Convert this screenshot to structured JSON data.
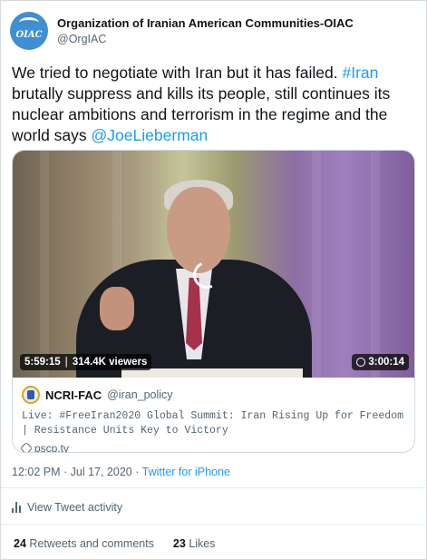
{
  "author": {
    "avatar_text": "OIAC",
    "display_name": "Organization of Iranian American Communities-OIAC",
    "handle": "@OrgIAC"
  },
  "tweet": {
    "text_1": "We tried to negotiate with Iran but it has failed. ",
    "hashtag": "#Iran",
    "text_2": " brutally suppress and kills its people, still continues its nuclear ambitions and terrorism in the regime and the world says ",
    "mention": "@JoeLieberman"
  },
  "card": {
    "elapsed": "5:59:15",
    "viewers": "314.4K viewers",
    "duration": "3:00:14",
    "account_name": "NCRI-FAC",
    "account_handle": "@iran_policy",
    "title": "Live: #FreeIran2020 Global Summit: Iran Rising Up for Freedom | Resistance Units Key to Victory",
    "domain": "pscp.tv"
  },
  "meta": {
    "time": "12:02 PM",
    "dot": " · ",
    "date": "Jul 17, 2020",
    "source": "Twitter for iPhone"
  },
  "activity": {
    "label": "View Tweet activity"
  },
  "stats": {
    "retweets_count": "24",
    "retweets_label": "Retweets and comments",
    "likes_count": "23",
    "likes_label": "Likes"
  },
  "colors": {
    "link": "#1d9bf0",
    "secondary_text": "#536471",
    "avatar": "#3f8fd1"
  },
  "icons": [
    "verified-avatar-bird-icon",
    "spinner-icon",
    "clock-icon",
    "link-icon",
    "bar-chart-icon"
  ]
}
